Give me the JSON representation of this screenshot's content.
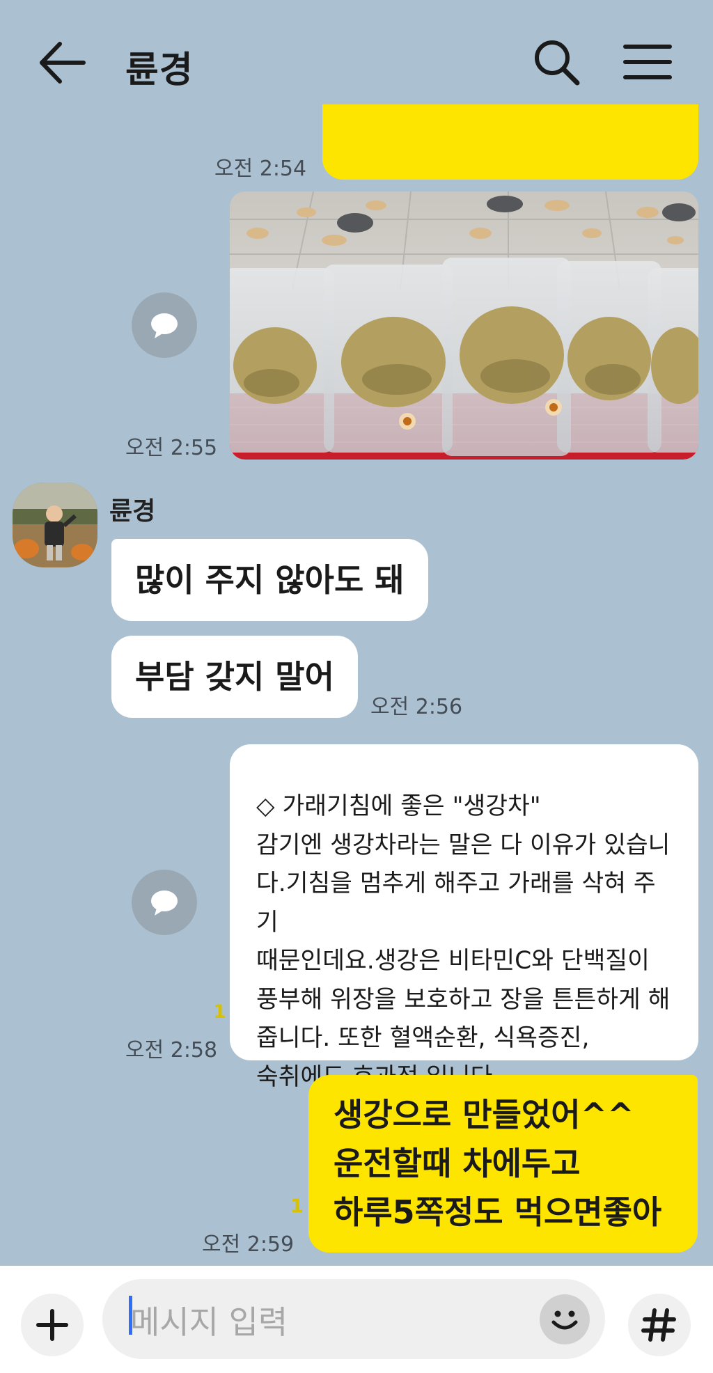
{
  "header": {
    "title": "륜경",
    "back_icon": "arrow-left-icon",
    "search_icon": "search-icon",
    "menu_icon": "hamburger-menu-icon"
  },
  "messages": {
    "m1_time": "오전 2:54",
    "m2_time": "오전 2:55",
    "sender_name": "륜경",
    "m3_text": "많이 주지 않아도 돼",
    "m4_text": "부담 갖지 말어",
    "m4_time": "오전 2:56",
    "m5_text": "◇ 가래기침에 좋은 \"생강차\"\n감기엔 생강차라는 말은 다 이유가 있습니\n다.기침을 멈추게 해주고 가래를 삭혀 주기\n때문인데요.생강은 비타민C와 단백질이\n풍부해 위장을 보호하고 장을 튼튼하게 해\n줍니다. 또한 혈액순환, 식욕증진,\n숙취에도 효과적 입니다.",
    "m5_unread": "1",
    "m5_time": "오전 2:58",
    "m6_text": "생강으로 만들었어^^\n운전할때 차에두고\n하루5쪽정도 먹으면좋아",
    "m6_unread": "1",
    "m6_time": "오전 2:59"
  },
  "input": {
    "placeholder": "메시지 입력",
    "plus_icon": "plus-icon",
    "emoji_icon": "emoji-icon",
    "hash_icon": "hash-icon"
  },
  "colors": {
    "background": "#abc1d1",
    "my_bubble": "#fee500",
    "their_bubble": "#ffffff",
    "unread": "#d8c200"
  }
}
